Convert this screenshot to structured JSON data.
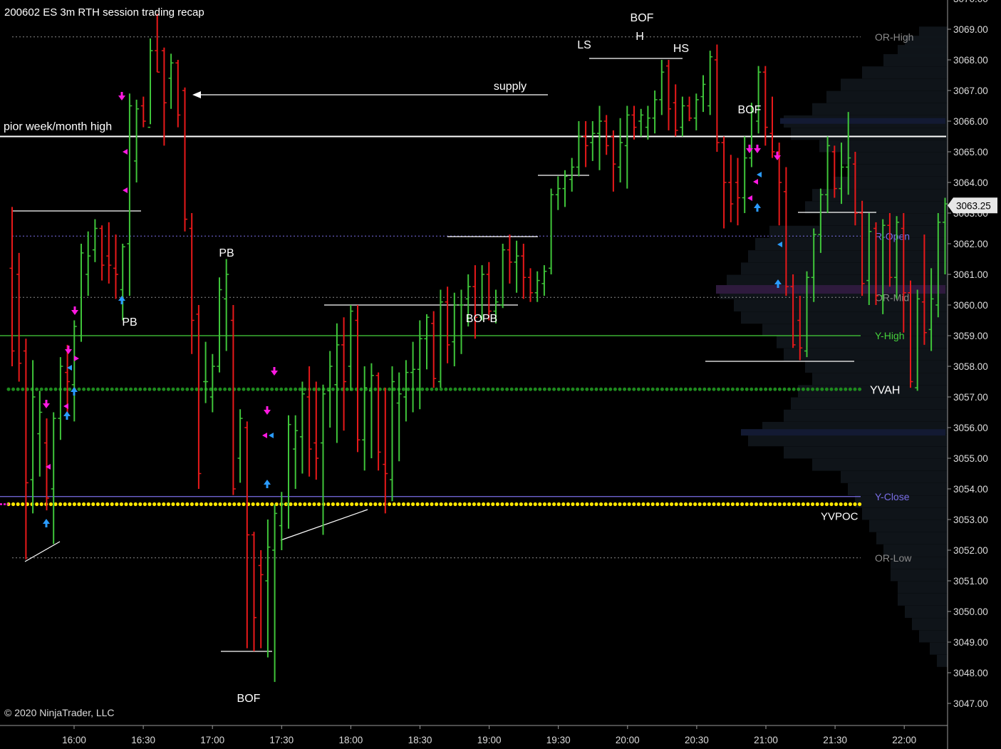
{
  "title": "200602 ES 3m RTH session trading recap",
  "copyright": "© 2020 NinjaTrader, LLC",
  "last_price_label": "3063.25",
  "colors": {
    "background": "#000000",
    "up_bar": "#3fc53a",
    "down_bar": "#e8191a",
    "axis_text": "#dcdcdc",
    "or_line": "#8a8a8a",
    "r_open": "#7a6ee6",
    "y_high": "#46d23c",
    "y_close": "#7a6ee6",
    "yvah": "#1e8a1e",
    "yvpoc": "#ffe600",
    "annotation": "#ffffff",
    "signal_down": "#ff19e1",
    "signal_up": "#2a9bff"
  },
  "chart_data": {
    "type": "ohlc",
    "timeframe": "3m",
    "x_axis": {
      "ticks": [
        "16:00",
        "16:30",
        "17:00",
        "17:30",
        "18:00",
        "18:30",
        "19:00",
        "19:30",
        "20:00",
        "20:30",
        "21:00",
        "21:30",
        "22:00"
      ]
    },
    "y_axis": {
      "range": [
        3046.5,
        3070.0
      ],
      "ticks": [
        "3047.00",
        "3048.00",
        "3049.00",
        "3050.00",
        "3051.00",
        "3052.00",
        "3053.00",
        "3054.00",
        "3055.00",
        "3056.00",
        "3057.00",
        "3058.00",
        "3059.00",
        "3060.00",
        "3061.00",
        "3062.00",
        "3063.00",
        "3064.00",
        "3065.00",
        "3066.00",
        "3067.00",
        "3068.00",
        "3069.00"
      ],
      "top_partial": "3070.00"
    },
    "levels": [
      {
        "name": "OR-High",
        "price": 3068.75,
        "style": "dotted",
        "color_key": "or_line"
      },
      {
        "name": "pior week/month high",
        "price": 3065.5,
        "style": "solid",
        "color_key": "annotation"
      },
      {
        "name": "R-Open",
        "price": 3062.25,
        "style": "dotted",
        "color_key": "r_open"
      },
      {
        "name": "OR-Mid",
        "price": 3060.25,
        "style": "dotted",
        "color_key": "or_line"
      },
      {
        "name": "Y-High",
        "price": 3059.0,
        "style": "solid",
        "color_key": "y_high"
      },
      {
        "name": "YVAH",
        "price": 3057.25,
        "style": "dots",
        "color_key": "yvah"
      },
      {
        "name": "Y-Close",
        "price": 3053.75,
        "style": "solid",
        "color_key": "y_close"
      },
      {
        "name": "YVPOC",
        "price": 3053.5,
        "style": "dots",
        "color_key": "yvpoc"
      },
      {
        "name": "OR-Low",
        "price": 3051.75,
        "style": "dotted",
        "color_key": "or_line"
      }
    ],
    "annotations": [
      {
        "text": "supply",
        "time": 88,
        "price": 3067.1
      },
      {
        "text": "PB",
        "time": 27,
        "price": 3062.0
      },
      {
        "text": "PB",
        "time": 17,
        "price": 3059.3
      },
      {
        "text": "BOF",
        "time": 33,
        "price": 3047.6
      },
      {
        "text": "BOPB",
        "time": 65,
        "price": 3059.3
      },
      {
        "text": "LS",
        "time": 80,
        "price": 3068.2
      },
      {
        "text": "H",
        "time": 88,
        "price": 3068.6
      },
      {
        "text": "BOF",
        "time": 88,
        "price": 3069.2
      },
      {
        "text": "HS",
        "time": 95,
        "price": 3067.9
      },
      {
        "text": "BOF",
        "time": 106,
        "price": 3066.2
      }
    ],
    "bars": [
      {
        "o": 3061.2,
        "h": 3063.2,
        "l": 3058.0,
        "c": 3058.5
      },
      {
        "o": 3061.0,
        "h": 3061.7,
        "l": 3057.5,
        "c": 3058.1
      },
      {
        "o": 3058.5,
        "h": 3058.9,
        "l": 3051.7,
        "c": 3054.2
      },
      {
        "o": 3054.3,
        "h": 3058.2,
        "l": 3053.2,
        "c": 3057.0
      },
      {
        "o": 3055.8,
        "h": 3057.2,
        "l": 3054.4,
        "c": 3056.5
      },
      {
        "o": 3055.5,
        "h": 3056.3,
        "l": 3053.3,
        "c": 3053.7
      },
      {
        "o": 3054.0,
        "h": 3056.5,
        "l": 3052.2,
        "c": 3056.3
      },
      {
        "o": 3056.3,
        "h": 3058.3,
        "l": 3055.6,
        "c": 3058.0
      },
      {
        "o": 3057.8,
        "h": 3058.7,
        "l": 3056.4,
        "c": 3057.5
      },
      {
        "o": 3057.4,
        "h": 3059.5,
        "l": 3056.2,
        "c": 3059.3
      },
      {
        "o": 3059.0,
        "h": 3062.0,
        "l": 3058.8,
        "c": 3061.7
      },
      {
        "o": 3061.0,
        "h": 3062.4,
        "l": 3060.3,
        "c": 3061.6
      },
      {
        "o": 3061.8,
        "h": 3062.8,
        "l": 3061.4,
        "c": 3062.5
      },
      {
        "o": 3062.5,
        "h": 3062.6,
        "l": 3060.8,
        "c": 3061.3
      },
      {
        "o": 3061.6,
        "h": 3062.7,
        "l": 3060.7,
        "c": 3061.3
      },
      {
        "o": 3061.2,
        "h": 3062.3,
        "l": 3060.2,
        "c": 3061.0
      },
      {
        "o": 3060.5,
        "h": 3062.0,
        "l": 3059.5,
        "c": 3061.9
      },
      {
        "o": 3062.0,
        "h": 3066.9,
        "l": 3060.3,
        "c": 3066.5
      },
      {
        "o": 3064.7,
        "h": 3066.7,
        "l": 3064.0,
        "c": 3066.4
      },
      {
        "o": 3066.5,
        "h": 3066.8,
        "l": 3065.8,
        "c": 3066.0
      },
      {
        "o": 3065.8,
        "h": 3068.7,
        "l": 3065.9,
        "c": 3068.3
      },
      {
        "o": 3068.3,
        "h": 3069.5,
        "l": 3067.6,
        "c": 3067.6
      },
      {
        "o": 3068.3,
        "h": 3068.4,
        "l": 3065.2,
        "c": 3066.6
      },
      {
        "o": 3067.4,
        "h": 3068.2,
        "l": 3066.4,
        "c": 3067.9
      },
      {
        "o": 3067.9,
        "h": 3068.0,
        "l": 3065.8,
        "c": 3066.2
      },
      {
        "o": 3067.0,
        "h": 3067.1,
        "l": 3062.4,
        "c": 3062.8
      },
      {
        "o": 3062.5,
        "h": 3063.0,
        "l": 3058.4,
        "c": 3059.5
      },
      {
        "o": 3059.7,
        "h": 3060.0,
        "l": 3054.0,
        "c": 3054.5
      },
      {
        "o": 3057.5,
        "h": 3058.8,
        "l": 3056.8,
        "c": 3057.5
      },
      {
        "o": 3057.0,
        "h": 3058.4,
        "l": 3056.5,
        "c": 3058.0
      },
      {
        "o": 3058.0,
        "h": 3060.9,
        "l": 3057.8,
        "c": 3060.5
      },
      {
        "o": 3060.2,
        "h": 3061.5,
        "l": 3058.5,
        "c": 3061.0
      },
      {
        "o": 3059.5,
        "h": 3060.0,
        "l": 3053.8,
        "c": 3054.0
      },
      {
        "o": 3055.0,
        "h": 3056.6,
        "l": 3054.2,
        "c": 3056.3
      },
      {
        "o": 3056.0,
        "h": 3056.2,
        "l": 3048.8,
        "c": 3052.5
      },
      {
        "o": 3052.5,
        "h": 3052.6,
        "l": 3048.7,
        "c": 3049.8
      },
      {
        "o": 3051.5,
        "h": 3052.0,
        "l": 3048.8,
        "c": 3051.2
      },
      {
        "o": 3051.0,
        "h": 3053.0,
        "l": 3048.5,
        "c": 3052.1
      },
      {
        "o": 3052.0,
        "h": 3053.5,
        "l": 3047.7,
        "c": 3053.2
      },
      {
        "o": 3052.8,
        "h": 3053.9,
        "l": 3052.0,
        "c": 3053.5
      },
      {
        "o": 3053.5,
        "h": 3056.4,
        "l": 3052.7,
        "c": 3056.1
      },
      {
        "o": 3055.3,
        "h": 3056.4,
        "l": 3054.0,
        "c": 3055.9
      },
      {
        "o": 3055.7,
        "h": 3057.5,
        "l": 3054.5,
        "c": 3057.1
      },
      {
        "o": 3057.0,
        "h": 3058.0,
        "l": 3054.4,
        "c": 3055.3
      },
      {
        "o": 3055.5,
        "h": 3057.5,
        "l": 3054.3,
        "c": 3055.0
      },
      {
        "o": 3055.5,
        "h": 3057.4,
        "l": 3052.5,
        "c": 3057.1
      },
      {
        "o": 3057.2,
        "h": 3058.5,
        "l": 3056.0,
        "c": 3058.0
      },
      {
        "o": 3057.4,
        "h": 3059.4,
        "l": 3055.5,
        "c": 3058.7
      },
      {
        "o": 3058.7,
        "h": 3059.6,
        "l": 3055.9,
        "c": 3057.5
      },
      {
        "o": 3058.0,
        "h": 3060.0,
        "l": 3057.2,
        "c": 3059.8
      },
      {
        "o": 3059.5,
        "h": 3060.0,
        "l": 3055.2,
        "c": 3055.6
      },
      {
        "o": 3055.6,
        "h": 3058.0,
        "l": 3054.6,
        "c": 3057.3
      },
      {
        "o": 3057.2,
        "h": 3058.1,
        "l": 3055.0,
        "c": 3057.7
      },
      {
        "o": 3057.7,
        "h": 3057.8,
        "l": 3054.6,
        "c": 3055.2
      },
      {
        "o": 3054.8,
        "h": 3057.3,
        "l": 3053.2,
        "c": 3054.5
      },
      {
        "o": 3054.3,
        "h": 3058.0,
        "l": 3053.6,
        "c": 3057.5
      },
      {
        "o": 3056.8,
        "h": 3057.8,
        "l": 3054.9,
        "c": 3057.1
      },
      {
        "o": 3057.0,
        "h": 3058.2,
        "l": 3056.2,
        "c": 3057.8
      },
      {
        "o": 3057.8,
        "h": 3058.8,
        "l": 3056.5,
        "c": 3057.9
      },
      {
        "o": 3057.9,
        "h": 3059.5,
        "l": 3056.6,
        "c": 3058.9
      },
      {
        "o": 3058.9,
        "h": 3059.7,
        "l": 3057.9,
        "c": 3059.6
      },
      {
        "o": 3059.4,
        "h": 3059.8,
        "l": 3057.3,
        "c": 3057.6
      },
      {
        "o": 3057.5,
        "h": 3060.5,
        "l": 3057.3,
        "c": 3060.1
      },
      {
        "o": 3060.1,
        "h": 3060.6,
        "l": 3058.1,
        "c": 3058.7
      },
      {
        "o": 3058.8,
        "h": 3060.4,
        "l": 3058.0,
        "c": 3060.0
      },
      {
        "o": 3060.0,
        "h": 3060.5,
        "l": 3058.4,
        "c": 3060.0
      },
      {
        "o": 3060.2,
        "h": 3061.0,
        "l": 3059.3,
        "c": 3060.6
      },
      {
        "o": 3060.6,
        "h": 3061.3,
        "l": 3058.9,
        "c": 3059.6
      },
      {
        "o": 3059.6,
        "h": 3061.3,
        "l": 3059.5,
        "c": 3061.0
      },
      {
        "o": 3061.0,
        "h": 3061.4,
        "l": 3059.5,
        "c": 3059.8
      },
      {
        "o": 3059.8,
        "h": 3060.5,
        "l": 3059.4,
        "c": 3060.1
      },
      {
        "o": 3060.0,
        "h": 3062.0,
        "l": 3059.9,
        "c": 3061.8
      },
      {
        "o": 3061.8,
        "h": 3062.3,
        "l": 3060.7,
        "c": 3061.4
      },
      {
        "o": 3061.4,
        "h": 3062.1,
        "l": 3060.4,
        "c": 3061.6
      },
      {
        "o": 3061.6,
        "h": 3062.0,
        "l": 3060.2,
        "c": 3060.9
      },
      {
        "o": 3060.9,
        "h": 3061.2,
        "l": 3060.1,
        "c": 3060.4
      },
      {
        "o": 3060.4,
        "h": 3061.1,
        "l": 3060.1,
        "c": 3060.8
      },
      {
        "o": 3060.7,
        "h": 3061.3,
        "l": 3060.3,
        "c": 3061.1
      },
      {
        "o": 3061.2,
        "h": 3063.8,
        "l": 3061.0,
        "c": 3063.6
      },
      {
        "o": 3063.6,
        "h": 3064.2,
        "l": 3063.1,
        "c": 3063.8
      },
      {
        "o": 3063.8,
        "h": 3064.4,
        "l": 3063.2,
        "c": 3064.2
      },
      {
        "o": 3064.1,
        "h": 3064.8,
        "l": 3063.7,
        "c": 3064.5
      },
      {
        "o": 3064.5,
        "h": 3066.0,
        "l": 3064.2,
        "c": 3065.5
      },
      {
        "o": 3065.5,
        "h": 3066.0,
        "l": 3064.5,
        "c": 3065.2
      },
      {
        "o": 3065.3,
        "h": 3066.0,
        "l": 3064.7,
        "c": 3065.6
      },
      {
        "o": 3065.6,
        "h": 3066.5,
        "l": 3064.4,
        "c": 3066.0
      },
      {
        "o": 3066.0,
        "h": 3066.2,
        "l": 3064.9,
        "c": 3065.2
      },
      {
        "o": 3065.5,
        "h": 3065.7,
        "l": 3063.7,
        "c": 3064.6
      },
      {
        "o": 3064.5,
        "h": 3066.1,
        "l": 3064.0,
        "c": 3065.3
      },
      {
        "o": 3065.2,
        "h": 3066.5,
        "l": 3063.8,
        "c": 3066.2
      },
      {
        "o": 3066.2,
        "h": 3066.5,
        "l": 3065.4,
        "c": 3065.8
      },
      {
        "o": 3066.0,
        "h": 3066.4,
        "l": 3065.5,
        "c": 3066.2
      },
      {
        "o": 3065.8,
        "h": 3066.5,
        "l": 3065.4,
        "c": 3066.1
      },
      {
        "o": 3066.1,
        "h": 3067.0,
        "l": 3065.6,
        "c": 3066.7
      },
      {
        "o": 3066.7,
        "h": 3068.0,
        "l": 3066.2,
        "c": 3067.6
      },
      {
        "o": 3067.8,
        "h": 3068.0,
        "l": 3065.7,
        "c": 3066.4
      },
      {
        "o": 3066.6,
        "h": 3067.2,
        "l": 3065.5,
        "c": 3065.7
      },
      {
        "o": 3065.8,
        "h": 3066.8,
        "l": 3065.5,
        "c": 3066.5
      },
      {
        "o": 3066.5,
        "h": 3066.8,
        "l": 3066.0,
        "c": 3066.1
      },
      {
        "o": 3066.1,
        "h": 3066.9,
        "l": 3065.7,
        "c": 3066.7
      },
      {
        "o": 3066.8,
        "h": 3067.5,
        "l": 3066.3,
        "c": 3067.2
      },
      {
        "o": 3066.5,
        "h": 3068.3,
        "l": 3066.2,
        "c": 3068.1
      },
      {
        "o": 3068.0,
        "h": 3068.5,
        "l": 3065.0,
        "c": 3065.3
      },
      {
        "o": 3065.3,
        "h": 3065.5,
        "l": 3062.5,
        "c": 3064.0
      },
      {
        "o": 3064.0,
        "h": 3064.9,
        "l": 3062.7,
        "c": 3063.3
      },
      {
        "o": 3064.0,
        "h": 3064.8,
        "l": 3062.6,
        "c": 3063.5
      },
      {
        "o": 3063.5,
        "h": 3065.5,
        "l": 3063.0,
        "c": 3064.8
      },
      {
        "o": 3064.8,
        "h": 3066.6,
        "l": 3064.5,
        "c": 3066.3
      },
      {
        "o": 3066.0,
        "h": 3067.8,
        "l": 3065.6,
        "c": 3067.6
      },
      {
        "o": 3067.6,
        "h": 3067.8,
        "l": 3065.2,
        "c": 3065.8
      },
      {
        "o": 3065.6,
        "h": 3066.8,
        "l": 3064.8,
        "c": 3065.0
      },
      {
        "o": 3065.0,
        "h": 3065.3,
        "l": 3062.6,
        "c": 3064.0
      },
      {
        "o": 3063.7,
        "h": 3064.5,
        "l": 3060.3,
        "c": 3060.6
      },
      {
        "o": 3060.6,
        "h": 3061.0,
        "l": 3058.6,
        "c": 3058.7
      },
      {
        "o": 3059.5,
        "h": 3060.3,
        "l": 3058.2,
        "c": 3058.6
      },
      {
        "o": 3058.5,
        "h": 3061.1,
        "l": 3058.3,
        "c": 3060.9
      },
      {
        "o": 3060.9,
        "h": 3062.5,
        "l": 3060.1,
        "c": 3062.3
      },
      {
        "o": 3062.3,
        "h": 3063.8,
        "l": 3061.7,
        "c": 3063.6
      },
      {
        "o": 3063.6,
        "h": 3065.5,
        "l": 3063.0,
        "c": 3065.2
      },
      {
        "o": 3065.0,
        "h": 3065.2,
        "l": 3063.5,
        "c": 3063.8
      },
      {
        "o": 3063.8,
        "h": 3065.3,
        "l": 3063.3,
        "c": 3064.5
      },
      {
        "o": 3064.5,
        "h": 3066.3,
        "l": 3063.6,
        "c": 3064.8
      },
      {
        "o": 3064.6,
        "h": 3065.0,
        "l": 3062.6,
        "c": 3063.0
      },
      {
        "o": 3063.0,
        "h": 3063.4,
        "l": 3060.3,
        "c": 3060.7
      },
      {
        "o": 3060.8,
        "h": 3063.0,
        "l": 3060.0,
        "c": 3062.4
      },
      {
        "o": 3062.5,
        "h": 3062.7,
        "l": 3060.0,
        "c": 3060.3
      },
      {
        "o": 3060.3,
        "h": 3062.8,
        "l": 3059.7,
        "c": 3062.6
      },
      {
        "o": 3062.6,
        "h": 3063.0,
        "l": 3060.6,
        "c": 3060.9
      },
      {
        "o": 3060.9,
        "h": 3062.9,
        "l": 3060.2,
        "c": 3062.7
      },
      {
        "o": 3062.5,
        "h": 3063.0,
        "l": 3059.1,
        "c": 3060.4
      },
      {
        "o": 3060.4,
        "h": 3060.8,
        "l": 3057.3,
        "c": 3057.5
      },
      {
        "o": 3057.3,
        "h": 3060.5,
        "l": 3057.2,
        "c": 3060.2
      },
      {
        "o": 3060.1,
        "h": 3062.3,
        "l": 3058.7,
        "c": 3059.1
      },
      {
        "o": 3059.2,
        "h": 3061.2,
        "l": 3058.5,
        "c": 3060.2
      },
      {
        "o": 3060.0,
        "h": 3063.0,
        "l": 3059.6,
        "c": 3062.7
      },
      {
        "o": 3062.7,
        "h": 3063.5,
        "l": 3061.0,
        "c": 3063.3
      }
    ]
  }
}
